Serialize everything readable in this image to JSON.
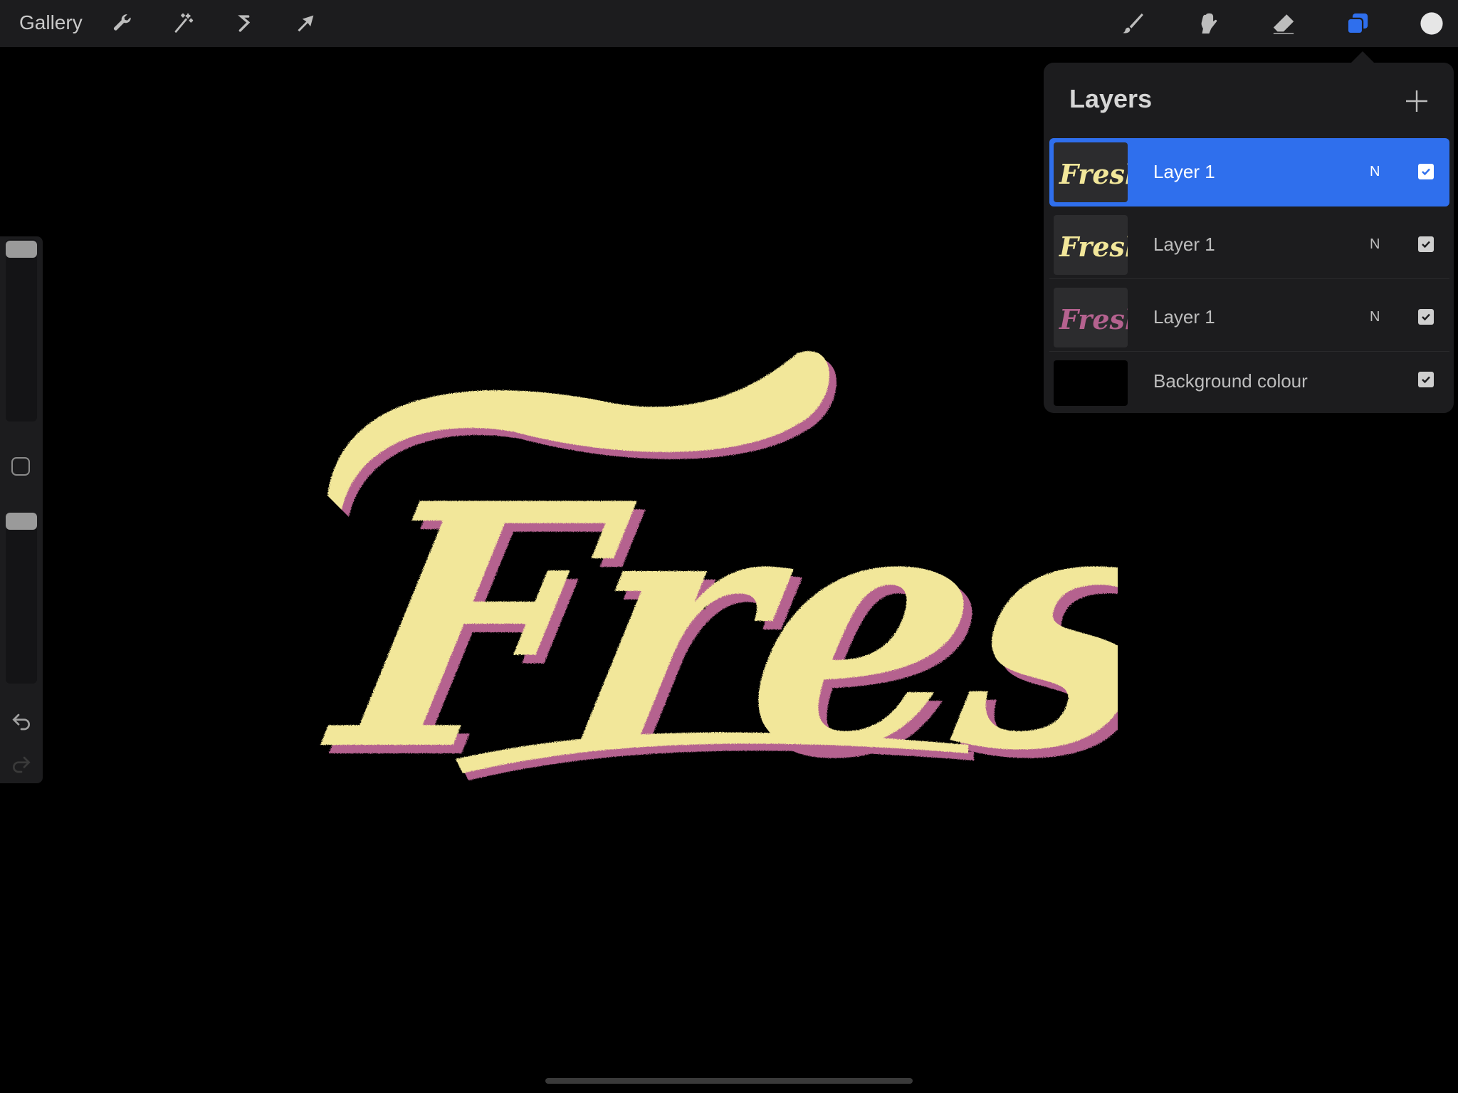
{
  "topbar": {
    "gallery_label": "Gallery",
    "left_tools": [
      "wrench-icon",
      "magic-wand-icon",
      "selection-icon",
      "transform-arrow-icon"
    ],
    "right_tools": [
      "brush-icon",
      "smudge-icon",
      "eraser-icon",
      "layers-icon",
      "color-swatch"
    ],
    "active_tool_color": "#2f6fed",
    "current_color": "#e6e6e6"
  },
  "artwork": {
    "text": "Fresh",
    "fill_color": "#f2e79a",
    "shadow_color": "#b5628f"
  },
  "layers_panel": {
    "title": "Layers",
    "layers": [
      {
        "name": "Layer 1",
        "blend": "N",
        "visible": true,
        "active": true,
        "thumb_color": "#f2e79a"
      },
      {
        "name": "Layer 1",
        "blend": "N",
        "visible": true,
        "active": false,
        "thumb_color": "#f2e79a"
      },
      {
        "name": "Layer 1",
        "blend": "N",
        "visible": true,
        "active": false,
        "thumb_color": "#b5628f"
      },
      {
        "name": "Background colour",
        "blend": "",
        "visible": true,
        "active": false,
        "thumb_color": "#000000"
      }
    ]
  }
}
